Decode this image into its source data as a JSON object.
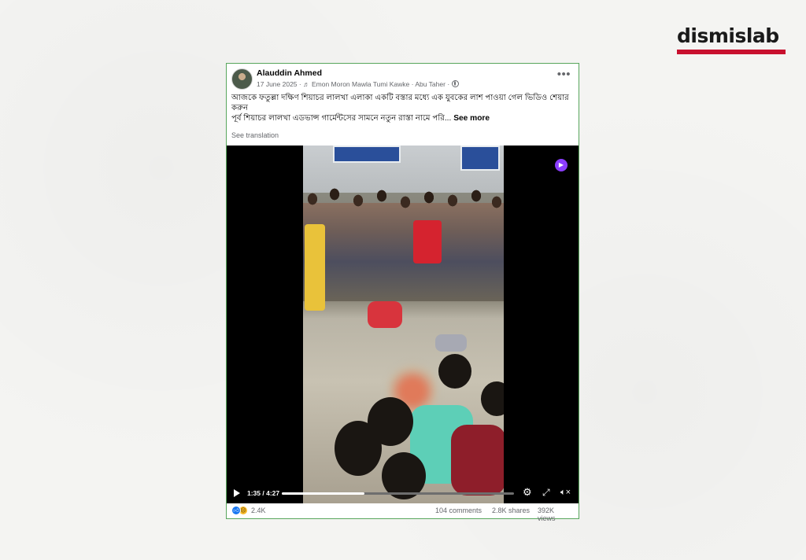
{
  "brand": {
    "name": "dismislab",
    "accent": "#c8102e"
  },
  "post": {
    "author": "Alauddin Ahmed",
    "date": "17 June 2025",
    "audio": "Emon Moron Mawla Tumi Kawke",
    "tagged": "Abu Taher",
    "visibility_icon": "globe-icon",
    "caption_line1": "আজকে ফতুল্লা দক্ষিণ শিয়াচর লালখা এলাকা একটি বস্তার মধ্যে এক যুবকের লাশ পাওয়া গেল ভিডিও শেয়ার করুন",
    "caption_line2": "পূর্ব শিয়াচর লালখা এডভান্স গার্মেন্টসের সামনে নতুন রাস্তা নামে পরি...",
    "see_more": "See more",
    "see_translation": "See translation"
  },
  "video": {
    "time": "1:35 / 4:27",
    "progress": 0.355
  },
  "stats": {
    "reactions": "2.4K",
    "comments": "104 comments",
    "shares": "2.8K shares",
    "views": "392K views"
  }
}
